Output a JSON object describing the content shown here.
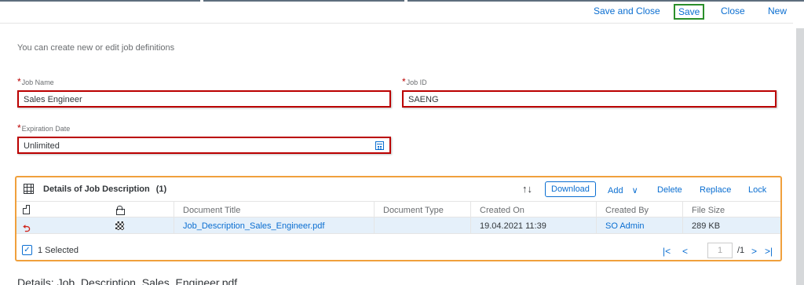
{
  "toolbar": {
    "save_close": "Save and Close",
    "save": "Save",
    "close": "Close",
    "new": "New"
  },
  "intro": "You can create new or edit job definitions",
  "form": {
    "job_name_label": "Job Name",
    "job_name_value": "Sales Engineer",
    "job_id_label": "Job ID",
    "job_id_value": "SAENG",
    "expiration_label": "Expiration Date",
    "expiration_value": "Unlimited",
    "required_mark": "*"
  },
  "panel": {
    "title": "Details of Job Description",
    "count": "(1)",
    "sort_glyph": "↑↓",
    "actions": {
      "download": "Download",
      "add": "Add",
      "add_chevron": "∨",
      "delete": "Delete",
      "replace": "Replace",
      "lock": "Lock"
    },
    "columns": [
      "Document Title",
      "Document Type",
      "Created On",
      "Created By",
      "File Size"
    ],
    "rows": [
      {
        "title": "Job_Description_Sales_Engineer.pdf",
        "type": "",
        "created_on": "19.04.2021 11:39",
        "created_by": "SO Admin",
        "file_size": "289 KB"
      }
    ],
    "selected_text": "1 Selected",
    "checkmark": "✓",
    "pager": {
      "first": "|<",
      "prev": "<",
      "page": "1",
      "total": "/1",
      "next": ">",
      "last": ">|"
    }
  },
  "details_heading": "Details: Job_Description_Sales_Engineer.pdf",
  "icons": {
    "pdf": "pdf-icon",
    "grid": "table-icon",
    "lock": "lock-icon",
    "calendar": "calendar-icon"
  },
  "colors": {
    "link": "#0a6ed1",
    "required": "#bb0000",
    "selection_row": "#e5f0fa",
    "panel_border": "#f0a03c"
  }
}
